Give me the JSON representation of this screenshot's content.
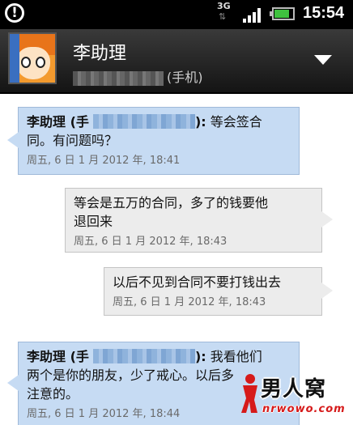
{
  "status_bar": {
    "network": "3G",
    "network_arrows": "⇅",
    "battery_level": 0.8,
    "time": "15:54"
  },
  "header": {
    "contact_name": "李助理",
    "number_label": "(手机)"
  },
  "messages": [
    {
      "direction": "incoming",
      "sender": "李助理 (手",
      "sender_suffix": "):",
      "text_line1": " 等会签合",
      "text_line2": "同。有问题吗？",
      "timestamp": "周五, 6 日 1 月 2012 年, 18:41"
    },
    {
      "direction": "outgoing",
      "text_line1": "等会是五万的合同，多了的钱要他",
      "text_line2": "退回来",
      "timestamp": "周五, 6 日 1 月 2012 年, 18:43"
    },
    {
      "direction": "outgoing",
      "text_line1": "以后不见到合同不要打钱出去",
      "timestamp": "周五, 6 日 1 月 2012 年, 18:43"
    },
    {
      "direction": "incoming",
      "sender": "李助理 (手",
      "sender_suffix": "):",
      "text_line1": " 我看他们",
      "text_line2": "两个是你的朋友，少了戒心。以后多",
      "text_line3": "注意的。",
      "timestamp": "周五, 6 日 1 月 2012 年, 18:44"
    }
  ],
  "watermark": {
    "title": "男人窝",
    "url": "nrwowo.com"
  },
  "colors": {
    "incoming_bubble": "#c6dbf3",
    "outgoing_bubble": "#ececec",
    "header": "#2a2a2a",
    "status_bar": "#000000"
  }
}
